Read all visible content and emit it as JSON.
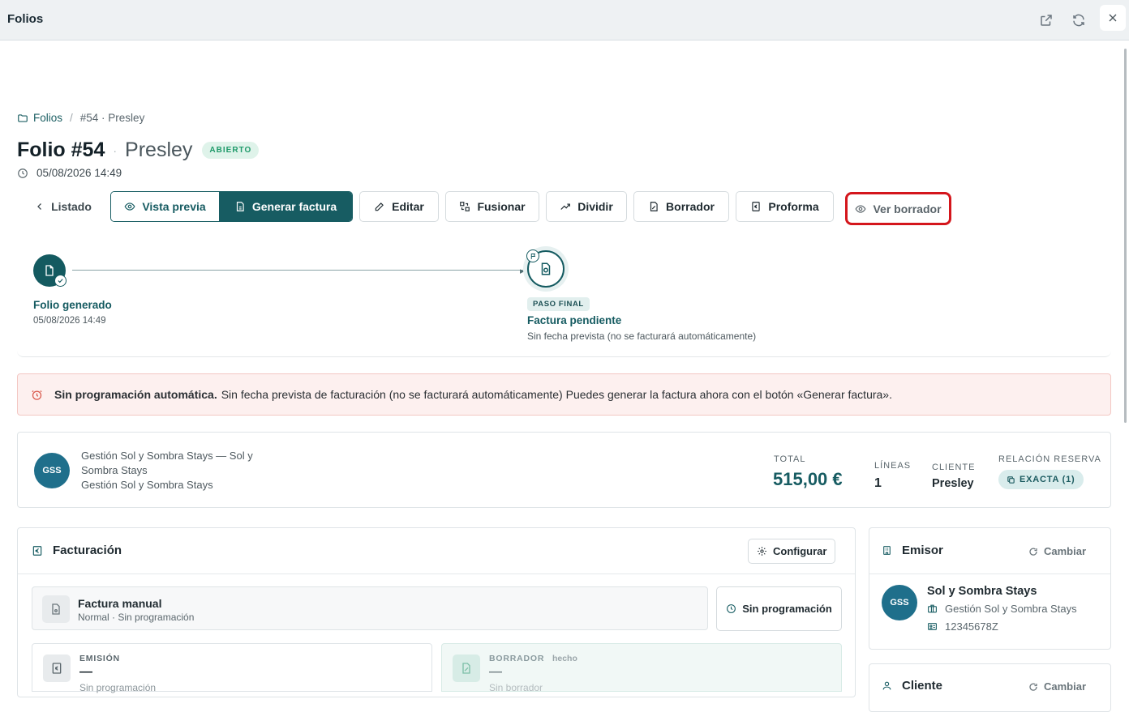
{
  "window": {
    "title": "Folios"
  },
  "breadcrumb": {
    "root": "Folios",
    "separator": "/",
    "current": "#54 · Presley"
  },
  "header": {
    "title": "Folio #54",
    "dot": "·",
    "guest": "Presley",
    "status": "ABIERTO",
    "created": "05/08/2026 14:49"
  },
  "toolbar": {
    "back": "Listado",
    "preview": "Vista previa",
    "generate": "Generar factura",
    "edit": "Editar",
    "merge": "Fusionar",
    "split": "Dividir",
    "draft": "Borrador",
    "proforma": "Proforma",
    "view_draft": "Ver borrador"
  },
  "timeline": {
    "step1_label": "Folio generado",
    "step1_date": "05/08/2026 14:49",
    "final_chip": "PASO FINAL",
    "step2_label": "Factura pendiente",
    "step2_desc": "Sin fecha prevista (no se facturará automáticamente)"
  },
  "alert": {
    "bold": "Sin programación automática.",
    "text": "Sin fecha prevista de facturación (no se facturará automáticamente) Puedes generar la factura ahora con el botón «Generar factura».",
    "color": "#fdf0ef"
  },
  "summary": {
    "avatar": "GSS",
    "line1": "Gestión Sol y Sombra Stays — Sol y Sombra Stays",
    "line2": "Gestión Sol y Sombra Stays",
    "total_label": "TOTAL",
    "total_value": "515,00 €",
    "lines_label": "LÍNEAS",
    "lines_value": "1",
    "client_label": "CLIENTE",
    "client_value": "Presley",
    "relation_label": "RELACIÓN RESERVA",
    "relation_value": "EXACTA (1)"
  },
  "billing": {
    "title": "Facturación",
    "configure": "Configurar",
    "manual_title": "Factura manual",
    "manual_sub": "Normal · Sin programación",
    "schedule": "Sin programación",
    "emission_label": "EMISIÓN",
    "emission_value": "—",
    "emission_sub": "Sin programación",
    "draft_label": "BORRADOR",
    "draft_done": "hecho",
    "draft_value": "—",
    "draft_sub": "Sin borrador"
  },
  "issuer": {
    "title": "Emisor",
    "change": "Cambiar",
    "avatar": "GSS",
    "name": "Sol y Sombra Stays",
    "company": "Gestión Sol y Sombra Stays",
    "tax_id": "12345678Z"
  },
  "client_card": {
    "title": "Cliente",
    "change": "Cambiar"
  },
  "colors": {
    "accent": "#175c62",
    "highlight": "#d4161c",
    "open_badge": "#1f9a6a"
  }
}
